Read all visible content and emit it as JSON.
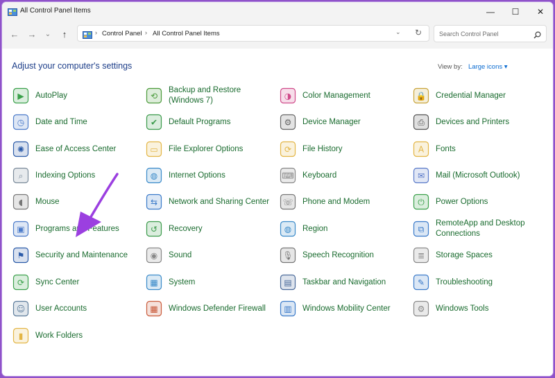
{
  "window": {
    "title": "All Control Panel Items",
    "buttons": {
      "minimize": "—",
      "maximize": "☐",
      "close": "✕"
    }
  },
  "nav": {
    "back": "←",
    "forward": "→",
    "recent": "⌄",
    "up": "↑",
    "breadcrumbs": [
      "Control Panel",
      "All Control Panel Items"
    ],
    "separator": "›",
    "dropdown": "⌄",
    "refresh": "↻",
    "search_placeholder": "Search Control Panel"
  },
  "content": {
    "heading": "Adjust your computer's settings",
    "view_by_label": "View by:",
    "view_by_value": "Large icons ▾",
    "items": [
      {
        "label": "AutoPlay",
        "icon": "autoplay-icon",
        "color": "#3aa04a"
      },
      {
        "label": "Backup and Restore (Windows 7)",
        "icon": "backup-icon",
        "color": "#4a9a3a"
      },
      {
        "label": "Color Management",
        "icon": "color-management-icon",
        "color": "#d04a8a"
      },
      {
        "label": "Credential Manager",
        "icon": "credential-icon",
        "color": "#c9a43a"
      },
      {
        "label": "Date and Time",
        "icon": "clock-icon",
        "color": "#4a7ac9"
      },
      {
        "label": "Default Programs",
        "icon": "default-programs-icon",
        "color": "#3a9a4a"
      },
      {
        "label": "Device Manager",
        "icon": "device-manager-icon",
        "color": "#666666"
      },
      {
        "label": "Devices and Printers",
        "icon": "printer-icon",
        "color": "#555555"
      },
      {
        "label": "Ease of Access Center",
        "icon": "ease-of-access-icon",
        "color": "#2a5aa8"
      },
      {
        "label": "File Explorer Options",
        "icon": "folder-icon",
        "color": "#e3b544"
      },
      {
        "label": "File History",
        "icon": "file-history-icon",
        "color": "#e3b544"
      },
      {
        "label": "Fonts",
        "icon": "fonts-icon",
        "color": "#e3b544"
      },
      {
        "label": "Indexing Options",
        "icon": "indexing-icon",
        "color": "#7a8a9a"
      },
      {
        "label": "Internet Options",
        "icon": "globe-icon",
        "color": "#3a8ac9"
      },
      {
        "label": "Keyboard",
        "icon": "keyboard-icon",
        "color": "#888888"
      },
      {
        "label": "Mail (Microsoft Outlook)",
        "icon": "mail-icon",
        "color": "#5a7ac9"
      },
      {
        "label": "Mouse",
        "icon": "mouse-icon",
        "color": "#777777"
      },
      {
        "label": "Network and Sharing Center",
        "icon": "network-icon",
        "color": "#3a7ac9"
      },
      {
        "label": "Phone and Modem",
        "icon": "phone-icon",
        "color": "#777777"
      },
      {
        "label": "Power Options",
        "icon": "power-icon",
        "color": "#3aa04a"
      },
      {
        "label": "Programs and Features",
        "icon": "programs-icon",
        "color": "#4a7ac9"
      },
      {
        "label": "Recovery",
        "icon": "recovery-icon",
        "color": "#3a9a4a"
      },
      {
        "label": "Region",
        "icon": "region-icon",
        "color": "#3a8ac9"
      },
      {
        "label": "RemoteApp and Desktop Connections",
        "icon": "remote-desktop-icon",
        "color": "#3a7ac9"
      },
      {
        "label": "Security and Maintenance",
        "icon": "flag-icon",
        "color": "#2a5aa8"
      },
      {
        "label": "Sound",
        "icon": "speaker-icon",
        "color": "#888888"
      },
      {
        "label": "Speech Recognition",
        "icon": "microphone-icon",
        "color": "#777777"
      },
      {
        "label": "Storage Spaces",
        "icon": "storage-icon",
        "color": "#888888"
      },
      {
        "label": "Sync Center",
        "icon": "sync-icon",
        "color": "#3aa04a"
      },
      {
        "label": "System",
        "icon": "system-icon",
        "color": "#3a8ac9"
      },
      {
        "label": "Taskbar and Navigation",
        "icon": "taskbar-icon",
        "color": "#4a6a9a"
      },
      {
        "label": "Troubleshooting",
        "icon": "troubleshooting-icon",
        "color": "#3a7ac9"
      },
      {
        "label": "User Accounts",
        "icon": "user-accounts-icon",
        "color": "#5a7a9a"
      },
      {
        "label": "Windows Defender Firewall",
        "icon": "firewall-icon",
        "color": "#c95a3a"
      },
      {
        "label": "Windows Mobility Center",
        "icon": "mobility-icon",
        "color": "#3a7ac9"
      },
      {
        "label": "Windows Tools",
        "icon": "gear-icon",
        "color": "#888888"
      },
      {
        "label": "Work Folders",
        "icon": "work-folders-icon",
        "color": "#e3b544"
      }
    ]
  },
  "colors": {
    "page_background": "#8f52c9",
    "link_text": "#196b2e",
    "heading_text": "#1e3f8a",
    "annotation_arrow": "#9b3fe0"
  }
}
